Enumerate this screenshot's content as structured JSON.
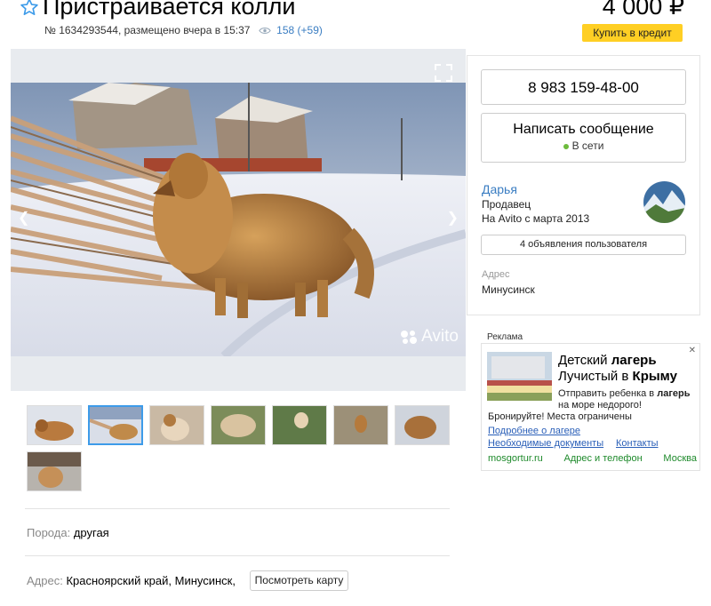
{
  "listing": {
    "title": "Пристраивается колли",
    "meta": "№ 1634293544, размещено вчера в 15:37",
    "views": "158 (+59)",
    "price": "4 000 ₽",
    "credit_button": "Купить в кредит"
  },
  "gallery": {
    "watermark": "Avito",
    "thumbnails_count": 8,
    "selected_thumbnail": 2
  },
  "params": {
    "breed_label": "Порода:",
    "breed_value": "другая",
    "address_label": "Адрес:",
    "address_value": "Красноярский край, Минусинск,",
    "map_button": "Посмотреть карту"
  },
  "seller": {
    "phone": "8 983 159-48-00",
    "message_button": "Написать сообщение",
    "online_status": "В сети",
    "name": "Дарья",
    "role": "Продавец",
    "since": "На Avito с марта 2013",
    "ads_button": "4 объявления пользователя",
    "address_label": "Адрес",
    "address_value": "Минусинск"
  },
  "ad": {
    "label": "Реклама",
    "close": "✕",
    "title_part1": "Детский ",
    "title_bold1": "лагерь",
    "title_part2": "Лучистый в ",
    "title_bold2": "Крыму",
    "text_part1": "Отправить ребенка в ",
    "text_bold": "лагерь",
    "text_part2": " на море недорого!",
    "text_line2": "Бронируйте! Места ограничены",
    "link_more": "Подробнее о лагере",
    "link_docs": "Необходимые документы",
    "link_contacts": "Контакты",
    "footer_site": "mosgortur.ru",
    "footer_address": "Адрес и телефон",
    "footer_city": "Москва"
  },
  "colors": {
    "accent_link": "#3a7dc2",
    "credit_button": "#ffcf24",
    "online": "#6dbb3c",
    "thumb_selected": "#3d9be9"
  }
}
